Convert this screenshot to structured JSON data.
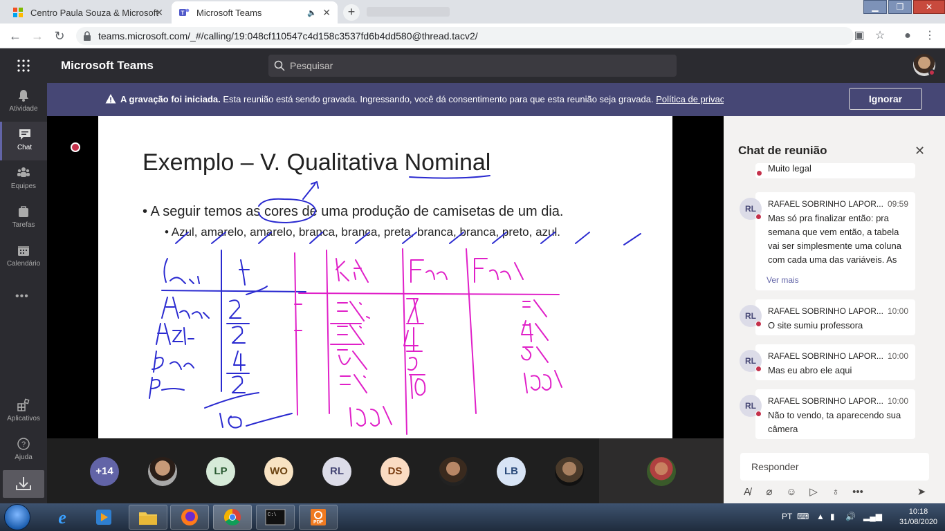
{
  "browser": {
    "tabs": [
      {
        "title": "Centro Paula Souza & Microsoft",
        "active": false
      },
      {
        "title": "Microsoft Teams",
        "active": true
      }
    ],
    "url": "teams.microsoft.com/_#/calling/19:048cf110547c4d158c3537fd6b4dd580@thread.tacv2/"
  },
  "teams": {
    "app_title": "Microsoft Teams",
    "search_placeholder": "Pesquisar"
  },
  "rail": {
    "items": [
      {
        "label": "Atividade",
        "icon": "bell-icon"
      },
      {
        "label": "Chat",
        "icon": "chat-icon",
        "active": true
      },
      {
        "label": "Equipes",
        "icon": "teams-icon"
      },
      {
        "label": "Tarefas",
        "icon": "tasks-icon"
      },
      {
        "label": "Calendário",
        "icon": "calendar-icon"
      }
    ],
    "more": "•••",
    "bottom": [
      {
        "label": "Aplicativos",
        "icon": "apps-icon"
      },
      {
        "label": "Ajuda",
        "icon": "help-icon"
      }
    ]
  },
  "banner": {
    "bold": "A gravação foi iniciada.",
    "text": "Esta reunião está sendo gravada. Ingressando, você dá consentimento para que esta reunião seja gravada.",
    "link": "Política de privacidade",
    "button": "Ignorar"
  },
  "slide": {
    "title": "Exemplo – V. Qualitativa Nominal",
    "bullet1": "• A seguir temos as cores de uma produção de camisetas de um dia.",
    "bullet2": "• Azul, amarelo, amarelo, branca, branca, preta, branca, branca, preto, azul."
  },
  "participants": [
    {
      "label": "+14",
      "bg": "#6264a7",
      "fg": "#ffffff"
    },
    {
      "label": "",
      "bg": "photo"
    },
    {
      "label": "LP",
      "bg": "#d6ead8",
      "fg": "#2b5a33"
    },
    {
      "label": "WO",
      "bg": "#f8e3c3",
      "fg": "#6b4312"
    },
    {
      "label": "RL",
      "bg": "#dcdce8",
      "fg": "#464775"
    },
    {
      "label": "DS",
      "bg": "#fadbc2",
      "fg": "#7a3d12"
    },
    {
      "label": "",
      "bg": "photo"
    },
    {
      "label": "LB",
      "bg": "#d8e4f5",
      "fg": "#2a4a7a"
    },
    {
      "label": "",
      "bg": "photo"
    }
  ],
  "chat": {
    "title": "Chat de reunião",
    "partial_message": "Muito legal",
    "messages": [
      {
        "avatar": "RL",
        "name": "RAFAEL SOBRINHO LAPOR...",
        "time": "09:59",
        "text": "Mas só pra finalizar então: pra semana que vem então, a tabela vai ser simplesmente uma coluna com cada uma das variáveis. As outras colunas",
        "more": "Ver mais"
      },
      {
        "avatar": "RL",
        "name": "RAFAEL SOBRINHO LAPOR...",
        "time": "10:00",
        "text": "O site sumiu professora"
      },
      {
        "avatar": "RL",
        "name": "RAFAEL SOBRINHO LAPOR...",
        "time": "10:00",
        "text": "Mas eu abro ele aqui"
      },
      {
        "avatar": "RL",
        "name": "RAFAEL SOBRINHO LAPOR...",
        "time": "10:00",
        "text": "Não to vendo, ta aparecendo sua câmera"
      }
    ],
    "reply_placeholder": "Responder"
  },
  "taskbar": {
    "lang": "PT",
    "time": "10:18",
    "date": "31/08/2020"
  },
  "colors": {
    "teams_purple": "#6264a7",
    "banner": "#464775",
    "ink_blue": "#2a2ad0",
    "ink_magenta": "#e020c8",
    "status_red": "#c4314b"
  }
}
